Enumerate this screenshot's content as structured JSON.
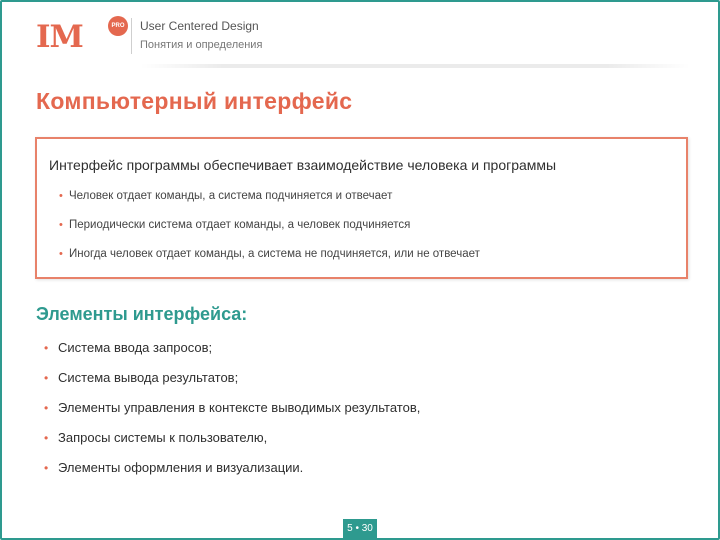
{
  "header": {
    "logo_text": "IM",
    "logo_badge": "PRO",
    "title": "User Centered Design",
    "subtitle": "Понятия и определения"
  },
  "slide_title": "Компьютерный интерфейс",
  "box": {
    "lead": "Интерфейс программы обеспечивает взаимодействие человека и программы",
    "items": [
      "Человек отдает команды, а система подчиняется и отвечает",
      "Периодически система отдает команды, а человек подчиняется",
      "Иногда человек отдает команды, а система не подчиняется, или не отвечает"
    ]
  },
  "elements": {
    "heading": "Элементы интерфейса:",
    "items": [
      "Система ввода запросов;",
      "Система вывода результатов;",
      "Элементы управления в контексте выводимых результатов,",
      "Запросы системы к пользователю,",
      "Элементы оформления и визуализации."
    ]
  },
  "page_number": "5 • 30",
  "colors": {
    "accent": "#e4684f",
    "teal": "#2e9a8f"
  }
}
